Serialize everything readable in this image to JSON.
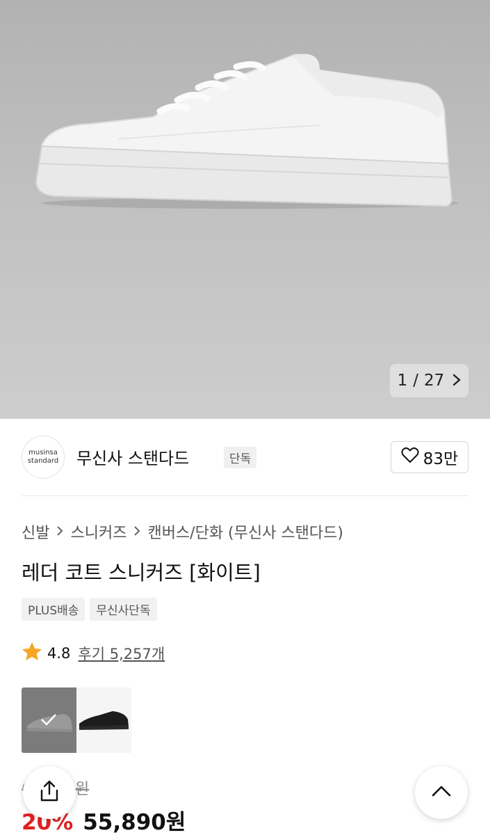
{
  "gallery": {
    "current": "1",
    "separator": "/",
    "total": "27",
    "next_icon": "chevron-right-icon"
  },
  "brand": {
    "logo_line1": "musinsa",
    "logo_line2": "standard",
    "name": "무신사 스탠다드",
    "tag": "단독",
    "likes": "83만"
  },
  "breadcrumb": [
    "신발",
    "스니커즈",
    "캔버스/단화 (무신사 스탠다드)"
  ],
  "product": {
    "title": "레더 코트 스니커즈 [화이트]",
    "tags": [
      "PLUS배송",
      "무신사단독"
    ]
  },
  "rating": {
    "score": "4.8",
    "reviews": "후기 5,257개"
  },
  "options": {
    "selected_color": "white",
    "colors": [
      "white",
      "black"
    ]
  },
  "pricing": {
    "original": "69,900원",
    "discount": "20%",
    "price": "55,890원"
  },
  "colors": {
    "accent_red": "#e02020",
    "star": "#f5a623"
  }
}
